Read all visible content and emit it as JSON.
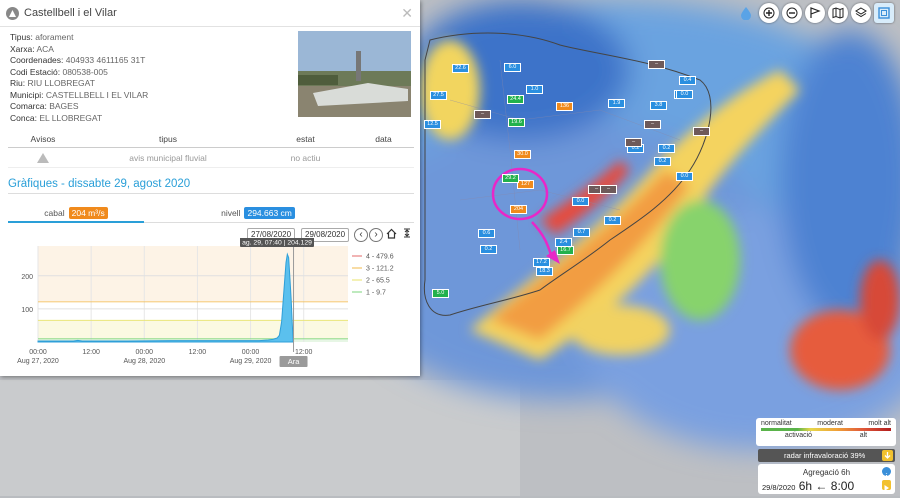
{
  "panel": {
    "title": "Castellbell i el Vilar",
    "close_glyph": "✕",
    "info": [
      {
        "label": "Tipus:",
        "value": "aforament"
      },
      {
        "label": "Xarxa:",
        "value": "ACA"
      },
      {
        "label": "Coordenades:",
        "value": "404933 4611165 31T"
      },
      {
        "label": "Codi Estació:",
        "value": "080538-005"
      },
      {
        "label": "Riu:",
        "value": "RIU LLOBREGAT"
      },
      {
        "label": "Municipi:",
        "value": "CASTELLBELL I EL VILAR"
      },
      {
        "label": "Comarca:",
        "value": "BAGES"
      },
      {
        "label": "Conca:",
        "value": "EL LLOBREGAT"
      }
    ],
    "avisos": {
      "headers": [
        "Avisos",
        "tipus",
        "estat",
        "data"
      ],
      "row": {
        "tipus": "avis municipal fluvial",
        "estat": "no actiu",
        "data": ""
      }
    },
    "section_title": "Gràfiques - dissabte 29, agost 2020",
    "tabs": [
      {
        "label": "cabal",
        "value": "204 m³/s",
        "color": "#f08a1c"
      },
      {
        "label": "nivell",
        "value": "294.663 cm",
        "color": "#2a8fe0"
      }
    ],
    "dates": {
      "from": "27/08/2020",
      "to": "29/08/2020"
    },
    "nav": {
      "prev": "‹",
      "next": "›"
    }
  },
  "chart_data": {
    "type": "area",
    "tooltip": "ag. 29, 07:40 | 204.129",
    "now_label": "Ara",
    "y_ticks": [
      100,
      200
    ],
    "ylim": [
      0,
      290
    ],
    "x_ticks": [
      {
        "t": 0,
        "line1": "00:00",
        "line2": "Aug 27, 2020"
      },
      {
        "t": 12,
        "line1": "12:00",
        "line2": ""
      },
      {
        "t": 24,
        "line1": "00:00",
        "line2": "Aug 28, 2020"
      },
      {
        "t": 36,
        "line1": "12:00",
        "line2": ""
      },
      {
        "t": 48,
        "line1": "00:00",
        "line2": "Aug 29, 2020"
      },
      {
        "t": 60,
        "line1": "12:00",
        "line2": ""
      }
    ],
    "xlim": [
      0,
      70
    ],
    "thresholds": [
      {
        "name": "4 - 479.6",
        "value": 479.6,
        "color": "#e36a6a"
      },
      {
        "name": "3 - 121.2",
        "value": 121.2,
        "color": "#f2b94b"
      },
      {
        "name": "2 - 65.5",
        "value": 65.5,
        "color": "#e8e36b"
      },
      {
        "name": "1 - 9.7",
        "value": 9.7,
        "color": "#7dd67d"
      }
    ],
    "series": [
      {
        "values": [
          [
            0,
            3
          ],
          [
            8,
            3
          ],
          [
            9,
            5
          ],
          [
            10,
            3
          ],
          [
            20,
            3
          ],
          [
            30,
            4
          ],
          [
            40,
            4
          ],
          [
            50,
            4
          ],
          [
            52,
            6
          ],
          [
            53,
            8
          ],
          [
            54,
            12
          ],
          [
            54.5,
            20
          ],
          [
            55,
            60
          ],
          [
            55.5,
            150
          ],
          [
            56,
            240
          ],
          [
            56.3,
            265
          ],
          [
            56.6,
            255
          ],
          [
            56.9,
            190
          ],
          [
            57.2,
            120
          ],
          [
            57.4,
            60
          ],
          [
            57.6,
            8
          ]
        ]
      }
    ]
  },
  "map": {
    "markers": [
      {
        "v": "22.6",
        "c": "#2a8fe0"
      },
      {
        "v": "6.0",
        "c": "#2a8fe0"
      },
      {
        "v": "27.5",
        "c": "#2a8fe0"
      },
      {
        "v": "1.0",
        "c": "#2a8fe0"
      },
      {
        "v": "24.4",
        "c": "#22b14c"
      },
      {
        "v": "136",
        "c": "#f08a1c"
      },
      {
        "v": "1.9",
        "c": "#2a8fe0"
      },
      {
        "v": "3.8",
        "c": "#2a8fe0"
      },
      {
        "v": "12.5",
        "c": "#2a8fe0"
      },
      {
        "v": "19.6",
        "c": "#22b14c"
      },
      {
        "v": "30.0",
        "c": "#f08a1c"
      },
      {
        "v": "127",
        "c": "#f08a1c"
      },
      {
        "v": "204",
        "c": "#f08a1c"
      },
      {
        "v": "0.0",
        "c": "#2a8fe0"
      },
      {
        "v": "0.2",
        "c": "#2a8fe0"
      },
      {
        "v": "29.2",
        "c": "#22b14c"
      },
      {
        "v": "0.6",
        "c": "#2a8fe0"
      },
      {
        "v": "0.2",
        "c": "#2a8fe0"
      },
      {
        "v": "17.2",
        "c": "#2a8fe0"
      },
      {
        "v": "18.3",
        "c": "#2a8fe0"
      },
      {
        "v": "2.4",
        "c": "#2a8fe0"
      },
      {
        "v": "16.7",
        "c": "#22b14c"
      },
      {
        "v": "0.7",
        "c": "#2a8fe0"
      },
      {
        "v": "5.0",
        "c": "#22b14c"
      },
      {
        "v": "0.4",
        "c": "#2a8fe0"
      },
      {
        "v": "0.0",
        "c": "#2a8fe0"
      },
      {
        "v": "0.2",
        "c": "#2a8fe0"
      },
      {
        "v": "0.2",
        "c": "#2a8fe0"
      },
      {
        "v": "0.0",
        "c": "#2a8fe0"
      },
      {
        "v": "0.2",
        "c": "#2a8fe0"
      },
      {
        "v": "0.0",
        "c": "#2a8fe0"
      }
    ]
  },
  "legend": {
    "top": [
      "normalitat",
      "moderat",
      "molt alt"
    ],
    "bottom": [
      "activació",
      "alt"
    ]
  },
  "radar": {
    "text": "radar infravaloració 39%"
  },
  "aggregation": {
    "title": "Agregació 6h",
    "date": "29/8/2020",
    "hours": "6h",
    "arrow": "←",
    "time": "8:00"
  },
  "toolbar": [
    "water-drop-icon",
    "zoom-in-icon",
    "zoom-out-icon",
    "flag-icon",
    "map-icon",
    "layers-icon",
    "frame-icon"
  ]
}
